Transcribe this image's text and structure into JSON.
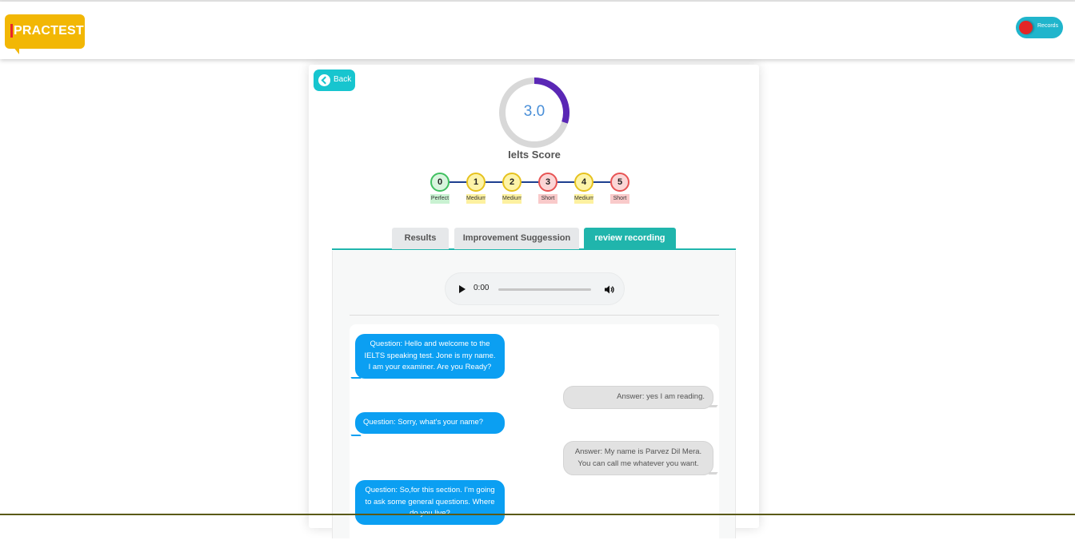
{
  "header": {
    "logo_text": "PRACTEST",
    "records_label": "Records",
    "colors": {
      "logo": "#f2b705",
      "toggle": "#20b5cc",
      "toggle_dot": "#e32626"
    }
  },
  "back_button": {
    "label": "Back",
    "icon": "chevron-left-circle-icon"
  },
  "score": {
    "value": "3.0",
    "title": "Ielts Score",
    "fraction": 0.3,
    "arc_color": "#5a27b5",
    "track_color": "#d8d8d8"
  },
  "steps": [
    {
      "number": "0",
      "tag": "Perfect",
      "status": "perfect"
    },
    {
      "number": "1",
      "tag": "Medium",
      "status": "medium"
    },
    {
      "number": "2",
      "tag": "Medium",
      "status": "medium"
    },
    {
      "number": "3",
      "tag": "Short",
      "status": "short"
    },
    {
      "number": "4",
      "tag": "Medium",
      "status": "medium"
    },
    {
      "number": "5",
      "tag": "Short",
      "status": "short"
    }
  ],
  "status_colors": {
    "perfect": {
      "fill": "#d8f5de",
      "border": "#40c060",
      "tag": "#c9f2d2"
    },
    "medium": {
      "fill": "#fdf4a8",
      "border": "#e6c21e",
      "tag": "#fdf1a0"
    },
    "short": {
      "fill": "#fbd6d6",
      "border": "#e85454",
      "tag": "#f9caca"
    }
  },
  "tabs": [
    {
      "label": "Results",
      "active": false
    },
    {
      "label": "Improvement Suggession",
      "active": false
    },
    {
      "label": "review recording",
      "active": true
    }
  ],
  "audio": {
    "time": "0:00",
    "progress": 0
  },
  "conversation": [
    {
      "role": "question",
      "text": "Question: Hello and welcome to the IELTS speaking test. Jone is my name. I am your examiner. Are you Ready?"
    },
    {
      "role": "answer",
      "text": "Answer: yes I am reading."
    },
    {
      "role": "question",
      "text": "Question: Sorry, what's your name?"
    },
    {
      "role": "answer",
      "text": "Answer: My name is Parvez Dil Mera. You can call me whatever you want."
    },
    {
      "role": "question",
      "text": "Question: So,for this section. I'm going to ask some general questions. Where do you live?"
    }
  ]
}
